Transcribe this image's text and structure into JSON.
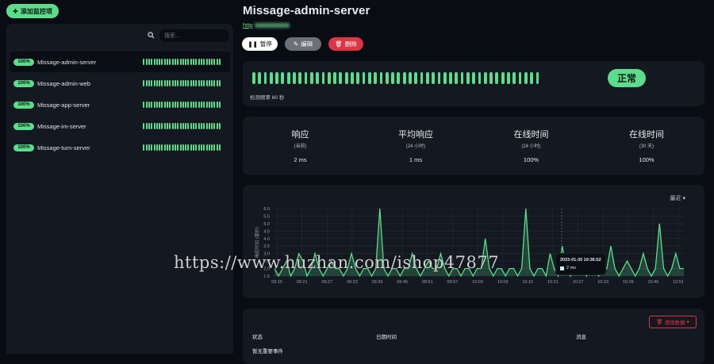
{
  "toolbar": {
    "add_label": "添加监控项"
  },
  "sidebar": {
    "search_placeholder": "搜索...",
    "monitors": [
      {
        "uptime": "100%",
        "name": "Missage-admin-server",
        "active": true
      },
      {
        "uptime": "100%",
        "name": "Missage-admin-web",
        "active": false
      },
      {
        "uptime": "100%",
        "name": "Missage-app-server",
        "active": false
      },
      {
        "uptime": "100%",
        "name": "Missage-im-server",
        "active": false
      },
      {
        "uptime": "100%",
        "name": "Missage-turn-server",
        "active": false
      }
    ]
  },
  "detail": {
    "title": "Missage-admin-server",
    "url_prefix": "http",
    "buttons": {
      "pause": "暂停",
      "edit": "编辑",
      "delete": "删除"
    },
    "status": "正常",
    "check_frequency": "检测频率 60 秒",
    "stats": [
      {
        "heading": "响应",
        "sub": "(当前)",
        "value": "2 ms"
      },
      {
        "heading": "平均响应",
        "sub": "(24 小时)",
        "value": "1 ms"
      },
      {
        "heading": "在线时间",
        "sub": "(24 小时)",
        "value": "100%"
      },
      {
        "heading": "在线时间",
        "sub": "(30 天)",
        "value": "100%"
      }
    ]
  },
  "chart_data": {
    "type": "area",
    "period_label": "最近",
    "ylabel": "响应时间 (毫秒)",
    "ylim": [
      1.5,
      6.0
    ],
    "yticks": [
      "6.0",
      "5.5",
      "5.0",
      "4.5",
      "4.0",
      "3.5",
      "3.0",
      "2.5",
      "2.0",
      "1.5"
    ],
    "xticks": [
      "09:15",
      "09:21",
      "09:27",
      "09:33",
      "09:39",
      "09:45",
      "09:51",
      "09:57",
      "10:03",
      "10:09",
      "10:15",
      "10:21",
      "10:27",
      "10:33",
      "10:39",
      "10:45",
      "10:51"
    ],
    "series": [
      {
        "values": [
          2,
          1.5,
          2,
          2.5,
          1.5,
          2,
          3,
          2.5,
          1.5,
          2,
          3,
          2,
          1.5,
          2,
          2.5,
          2,
          2,
          1.5,
          2,
          3,
          2,
          1.5,
          2,
          2,
          1.5,
          2,
          6,
          2,
          1.5,
          2,
          2,
          1.5,
          2,
          2,
          3,
          2,
          1.5,
          2,
          2.5,
          2,
          2,
          3,
          2,
          1.5,
          2,
          2,
          1.5,
          2,
          2,
          1.5,
          2,
          2,
          4,
          2,
          1.5,
          2,
          2,
          1.5,
          2,
          2,
          1.5,
          2,
          6,
          2,
          1.5,
          2,
          2,
          1.5,
          3,
          2,
          1.5,
          3.5,
          2,
          1.5,
          3,
          2,
          2,
          1.5,
          3,
          2,
          1.5,
          2,
          2,
          3.5,
          2,
          1.5,
          2,
          2.5,
          2,
          1.5,
          2,
          3,
          2,
          1.5,
          2,
          5,
          2,
          1.5,
          2,
          3,
          2,
          2
        ]
      }
    ],
    "tooltip": {
      "time": "2023-01-30 10:36:52",
      "value": "2 ms"
    }
  },
  "events": {
    "clear_label": "清除数据",
    "columns": [
      "状态",
      "日期时间",
      "消息"
    ],
    "empty_text": "暂无重要事件"
  },
  "watermark": "https://www.huzhan.com/ishop47877",
  "colors": {
    "accent": "#5cdd8b",
    "danger": "#dc3545",
    "bg": "#090c12",
    "card": "#141820"
  }
}
